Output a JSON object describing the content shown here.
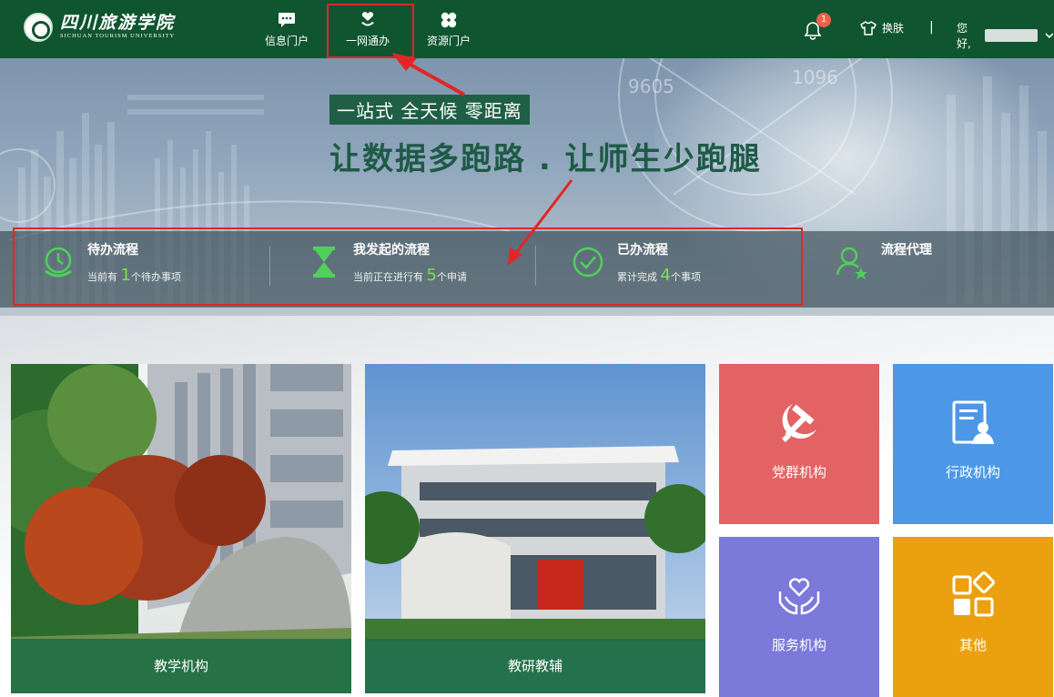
{
  "header": {
    "logo_cn": "四川旅游学院",
    "logo_en": "SICHUAN TOURISM UNIVERSITY",
    "nav": [
      {
        "label": "信息门户",
        "icon": "chat-icon"
      },
      {
        "label": "一网通办",
        "icon": "heart-hand-icon",
        "active": true
      },
      {
        "label": "资源门户",
        "icon": "clover-icon"
      }
    ],
    "notification_count": "1",
    "skin_label": "换肤",
    "separator": "|",
    "greeting": "您好,"
  },
  "banner": {
    "tagline": "一站式 全天候 零距离",
    "slogan": "让数据多跑路 . 让师生少跑腿",
    "stats": [
      {
        "title": "待办流程",
        "prefix": "当前有 ",
        "count": "1",
        "suffix": "个待办事项",
        "icon": "clock-icon"
      },
      {
        "title": "我发起的流程",
        "prefix": "当前正在进行有 ",
        "count": "5",
        "suffix": "个申请",
        "icon": "hourglass-icon"
      },
      {
        "title": "已办流程",
        "prefix": "累计完成 ",
        "count": "4",
        "suffix": "个事项",
        "icon": "check-circle-icon"
      },
      {
        "title": "流程代理",
        "icon": "user-star-icon"
      }
    ]
  },
  "sections": {
    "photos": [
      {
        "label": "教学机构"
      },
      {
        "label": "教研教辅"
      }
    ],
    "tiles": [
      {
        "label": "党群机构",
        "color": "#e36263",
        "icon": "hammer-sickle-icon"
      },
      {
        "label": "行政机构",
        "color": "#4d98e6",
        "icon": "document-user-icon"
      },
      {
        "label": "服务机构",
        "color": "#7b79d9",
        "icon": "hands-heart-icon"
      },
      {
        "label": "其他",
        "color": "#eba10f",
        "icon": "blocks-icon"
      }
    ]
  },
  "colors": {
    "header_bg": "#0f5530",
    "highlight": "#7ee04d",
    "annotation": "#e02727"
  }
}
